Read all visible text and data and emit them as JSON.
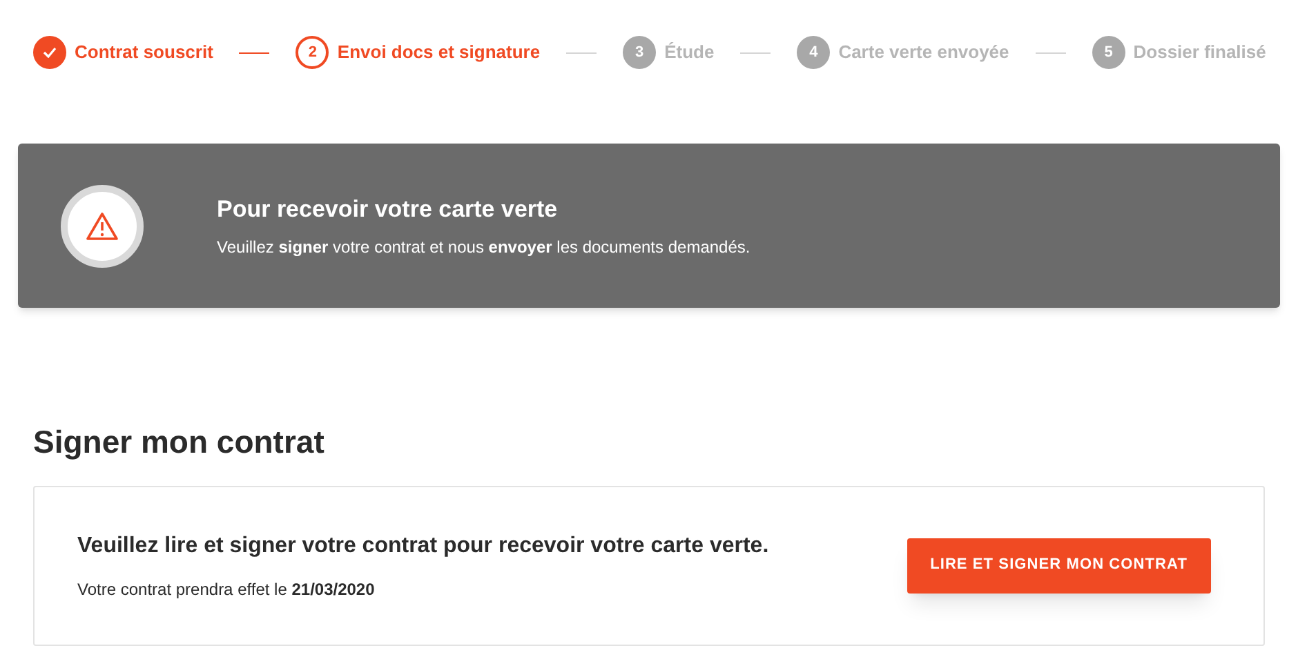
{
  "steps": [
    {
      "label": "Contrat souscrit",
      "kind": "done"
    },
    {
      "number": "2",
      "label": "Envoi docs et signature",
      "kind": "current"
    },
    {
      "number": "3",
      "label": "Étude",
      "kind": "todo"
    },
    {
      "number": "4",
      "label": "Carte verte envoyée",
      "kind": "todo"
    },
    {
      "number": "5",
      "label": "Dossier finalisé",
      "kind": "todo"
    }
  ],
  "alert": {
    "title": "Pour recevoir votre carte verte",
    "message": "Veuillez **signer** votre contrat et nous **envoyer** les documents demandés."
  },
  "section": {
    "title": "Signer mon contrat",
    "card_title": "Veuillez lire et signer votre contrat pour recevoir votre carte verte.",
    "card_text": "Votre contrat prendra effet le **21/03/2020**",
    "button": "LIRE ET SIGNER MON CONTRAT"
  }
}
